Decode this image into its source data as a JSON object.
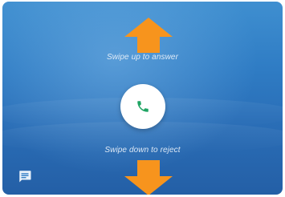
{
  "incoming_call": {
    "swipe_up_hint": "Swipe up to answer",
    "swipe_down_hint": "Swipe down to reject"
  },
  "icons": {
    "answer": "phone-icon",
    "message": "message-icon",
    "up_arrow": "arrow-up-icon",
    "down_arrow": "arrow-down-icon"
  },
  "colors": {
    "arrow": "#f7941d",
    "phone_icon": "#1fa463",
    "background_top": "#3f8fd0",
    "background_bottom": "#245fa6"
  }
}
